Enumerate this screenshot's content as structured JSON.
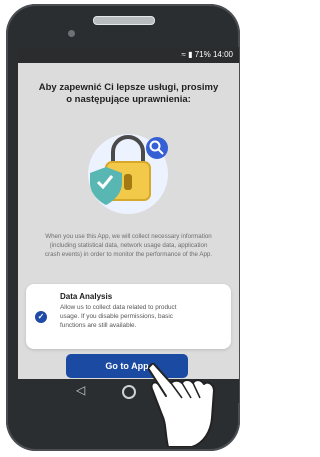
{
  "status_bar": {
    "text": "71% 14:00"
  },
  "dialog": {
    "title_line1": "Aby zapewnić Ci lepsze usługi, prosimy",
    "title_line2": "o następujące uprawnienia:",
    "info_line1": "When you use this App, we will collect necessary information",
    "info_line2": "(including statistical data, network usage data, application",
    "info_line3": "crash events) in order to monitor the performance of the App.",
    "permission": {
      "title": "Data Analysis",
      "desc_line1": "Allow us to collect data related to product",
      "desc_line2": "usage. If you disable permissions, basic",
      "desc_line3": "functions are still available."
    },
    "button_label": "Go to App"
  },
  "colors": {
    "accent": "#1b4aa3"
  }
}
